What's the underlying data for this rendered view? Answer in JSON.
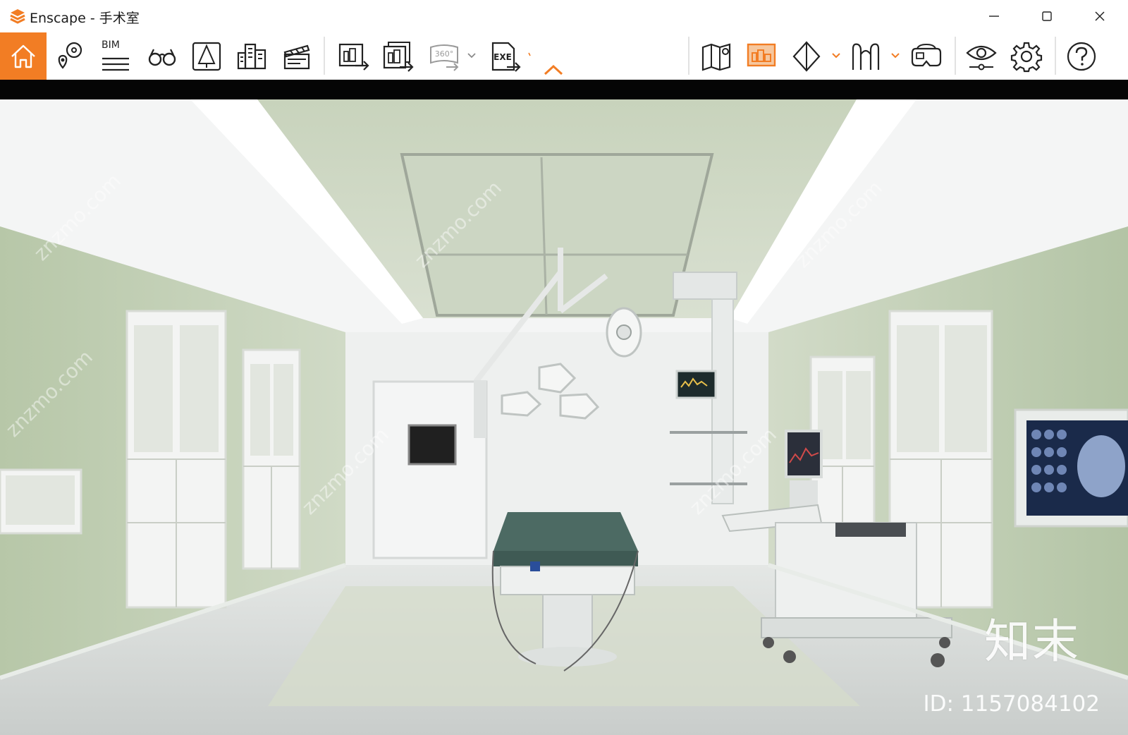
{
  "window": {
    "app_name": "Enscape",
    "title": "Enscape - 手术室",
    "controls": {
      "minimize_icon": "minimize-icon",
      "maximize_icon": "maximize-icon",
      "close_icon": "close-icon"
    }
  },
  "toolbar": {
    "accent_color": "#f27d24",
    "groups": [
      {
        "items": [
          "home-icon",
          "views-icon",
          "bim-icon",
          "binoculars-icon",
          "asset-library-icon",
          "site-context-icon",
          "video-editor-icon"
        ],
        "bim_label": "BIM"
      },
      {
        "items": [
          "render-image-icon",
          "batch-render-icon",
          "render-360-icon",
          "export-exe-icon"
        ],
        "label_360": "360°",
        "label_exe": "EXE"
      },
      {
        "items": [
          "map-icon",
          "atmosphere-icon",
          "section-icon",
          "people-icon",
          "vr-headset-icon"
        ]
      },
      {
        "items": [
          "visual-settings-icon",
          "settings-icon",
          "help-icon"
        ]
      }
    ],
    "collapse_icon": "chevron-up-icon"
  },
  "viewport": {
    "scene": "operating-room-render",
    "watermark_logo": "知末",
    "watermark_id": "ID: 1157084102",
    "watermark_site_icon": "znzmo-watermark"
  }
}
